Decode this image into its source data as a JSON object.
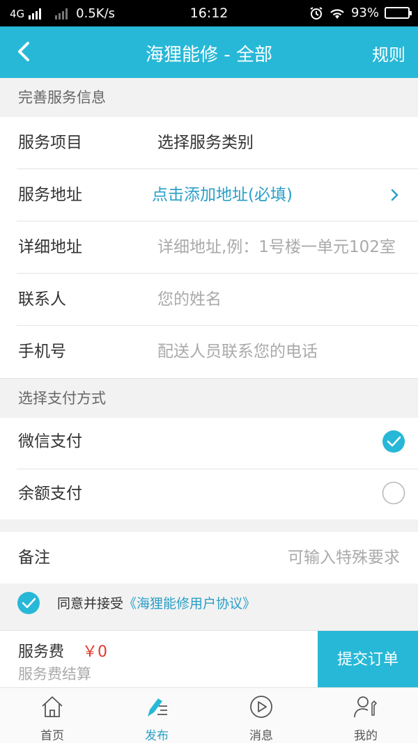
{
  "status_bar": {
    "network": "4G",
    "speed": "0.5K/s",
    "time": "16:12",
    "battery": "93%"
  },
  "nav": {
    "title": "海狸能修 - 全部",
    "rules": "规则",
    "back_icon": "chevron-left-icon"
  },
  "service_info": {
    "header": "完善服务信息",
    "rows": [
      {
        "label": "服务项目",
        "value": "选择服务类别",
        "kind": "value"
      },
      {
        "label": "服务地址",
        "value": "点击添加地址(必填)",
        "kind": "link"
      },
      {
        "label": "详细地址",
        "placeholder": "详细地址,例：1号楼一单元102室",
        "kind": "placeholder"
      },
      {
        "label": "联系人",
        "placeholder": "您的姓名",
        "kind": "placeholder"
      },
      {
        "label": "手机号",
        "placeholder": "配送人员联系您的电话",
        "kind": "placeholder"
      }
    ]
  },
  "payment": {
    "header": "选择支付方式",
    "options": [
      {
        "label": "微信支付",
        "selected": true
      },
      {
        "label": "余额支付",
        "selected": false
      }
    ]
  },
  "remark": {
    "label": "备注",
    "placeholder": "可输入特殊要求"
  },
  "agreement": {
    "checked": true,
    "text": "同意并接受",
    "link": "《海狸能修用户协议》"
  },
  "footer": {
    "fee_label": "服务费",
    "fee_amount": "￥0",
    "fee_sub": "服务费结算",
    "submit": "提交订单"
  },
  "tabbar": {
    "tabs": [
      {
        "label": "首页",
        "icon": "home-icon",
        "active": false
      },
      {
        "label": "发布",
        "icon": "pen-edit-icon",
        "active": true
      },
      {
        "label": "消息",
        "icon": "play-circle-icon",
        "active": false
      },
      {
        "label": "我的",
        "icon": "user-wrench-icon",
        "active": false
      }
    ]
  },
  "colors": {
    "accent": "#27b8d7",
    "link": "#2a9fc7",
    "price": "#e0392b"
  }
}
